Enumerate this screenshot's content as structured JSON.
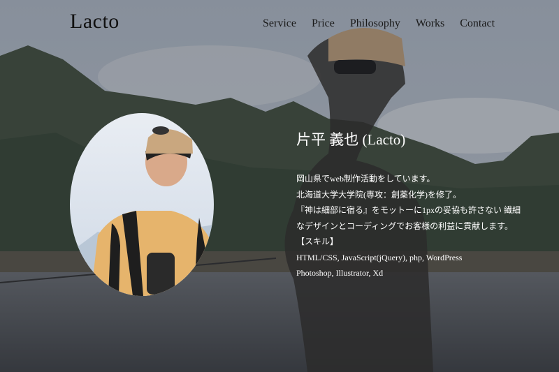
{
  "site": {
    "logo": "Lacto"
  },
  "nav": {
    "items": [
      "Service",
      "Price",
      "Philosophy",
      "Works",
      "Contact"
    ]
  },
  "profile": {
    "name": "片平 義也 (Lacto)",
    "bio": [
      "岡山県でweb制作活動をしています。",
      "北海道大学大学院(専攻：創薬化学)を修了。",
      "『神は細部に宿る』をモットーに1pxの妥協も許さない 繊細",
      "なデザインとコーディングでお客様の利益に貢献します。",
      "【スキル】",
      "HTML/CSS, JavaScript(jQuery), php, WordPress",
      "Photoshop, Illustrator, Xd"
    ]
  },
  "colors": {
    "text_light": "#ffffff",
    "text_dark": "#1a1a1a",
    "overlay": "#2a2f36"
  }
}
